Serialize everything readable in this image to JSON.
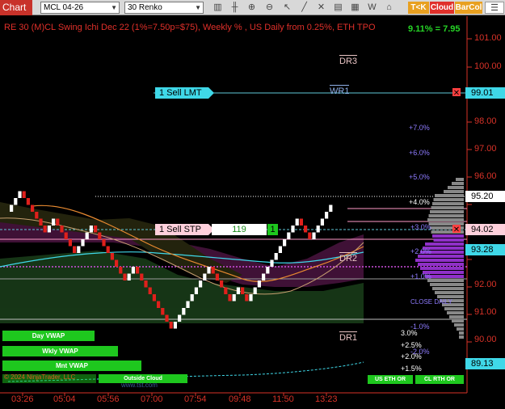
{
  "toolbar": {
    "chart_label": "Chart",
    "symbol": "MCL 04-26",
    "interval": "30 Renko",
    "tok_label": "T<K",
    "cloud_label": "Cloud",
    "barcol_label": "BarCol",
    "tok_color": "#e8a020",
    "cloud_color": "#e0302a",
    "barcol_color": "#e8a020"
  },
  "chart": {
    "title": "RE 30 (M)CL Swing Ichi Dec 22  (1%=7.50p=$75), Weekly % , US Daily from 0.25%, ETH TPO",
    "pct_change": "9.11% = 7.95",
    "price_axis": [
      "101.00",
      "100.00",
      "99.00",
      "98.00",
      "97.00",
      "96.00",
      "95.00",
      "94.00",
      "93.00",
      "92.00",
      "91.00",
      "90.00"
    ],
    "time_axis": [
      "03:26",
      "05:04",
      "05:56",
      "07:00",
      "07:54",
      "09:48",
      "11:50",
      "13:23"
    ],
    "weekly_pct": [
      "+7.0%",
      "+6.0%",
      "+5.0%",
      "+4.0%",
      "+3.0%",
      "+2.0%",
      "+1.0%",
      "-1.0%"
    ],
    "daily_pct": [
      "3.0%",
      "+2.5%",
      "+2.0%",
      "+1.5%"
    ],
    "daily_pct_extra": "-2.0%",
    "close_label": "CLOSE DAILY",
    "dr_labels": [
      "DR3",
      "WR1",
      "DR2",
      "DR1"
    ],
    "price_boxes": {
      "top": "99.01",
      "p95": "95.20",
      "p94": "94.02",
      "p93": "93.28",
      "p89": "89.13"
    },
    "orders": {
      "sell_lmt": "1 Sell LMT",
      "sell_stp": "1 Sell STP",
      "stp_qty": "119",
      "stp_count": "1"
    },
    "vwap_buttons": [
      "Day VWAP",
      "Wkly VWAP",
      "Mnt VWAP"
    ],
    "outside_cloud": "Outside Cloud",
    "us_eth_or": "US ETH OR",
    "cl_rth_or": "CL RTH OR",
    "copyright": "© 2024 NinjaTrader, LLC",
    "site": "www.tst.com",
    "colors": {
      "up_brick": "#ffffff",
      "down_brick": "#e0201c",
      "price_red": "#d83228",
      "cloud_green": "#1e5a1e",
      "cloud_purple": "#5a1e5a",
      "profile_purple": "#9030c8",
      "profile_grey": "#888888",
      "cyan": "#3fd8e8"
    }
  }
}
